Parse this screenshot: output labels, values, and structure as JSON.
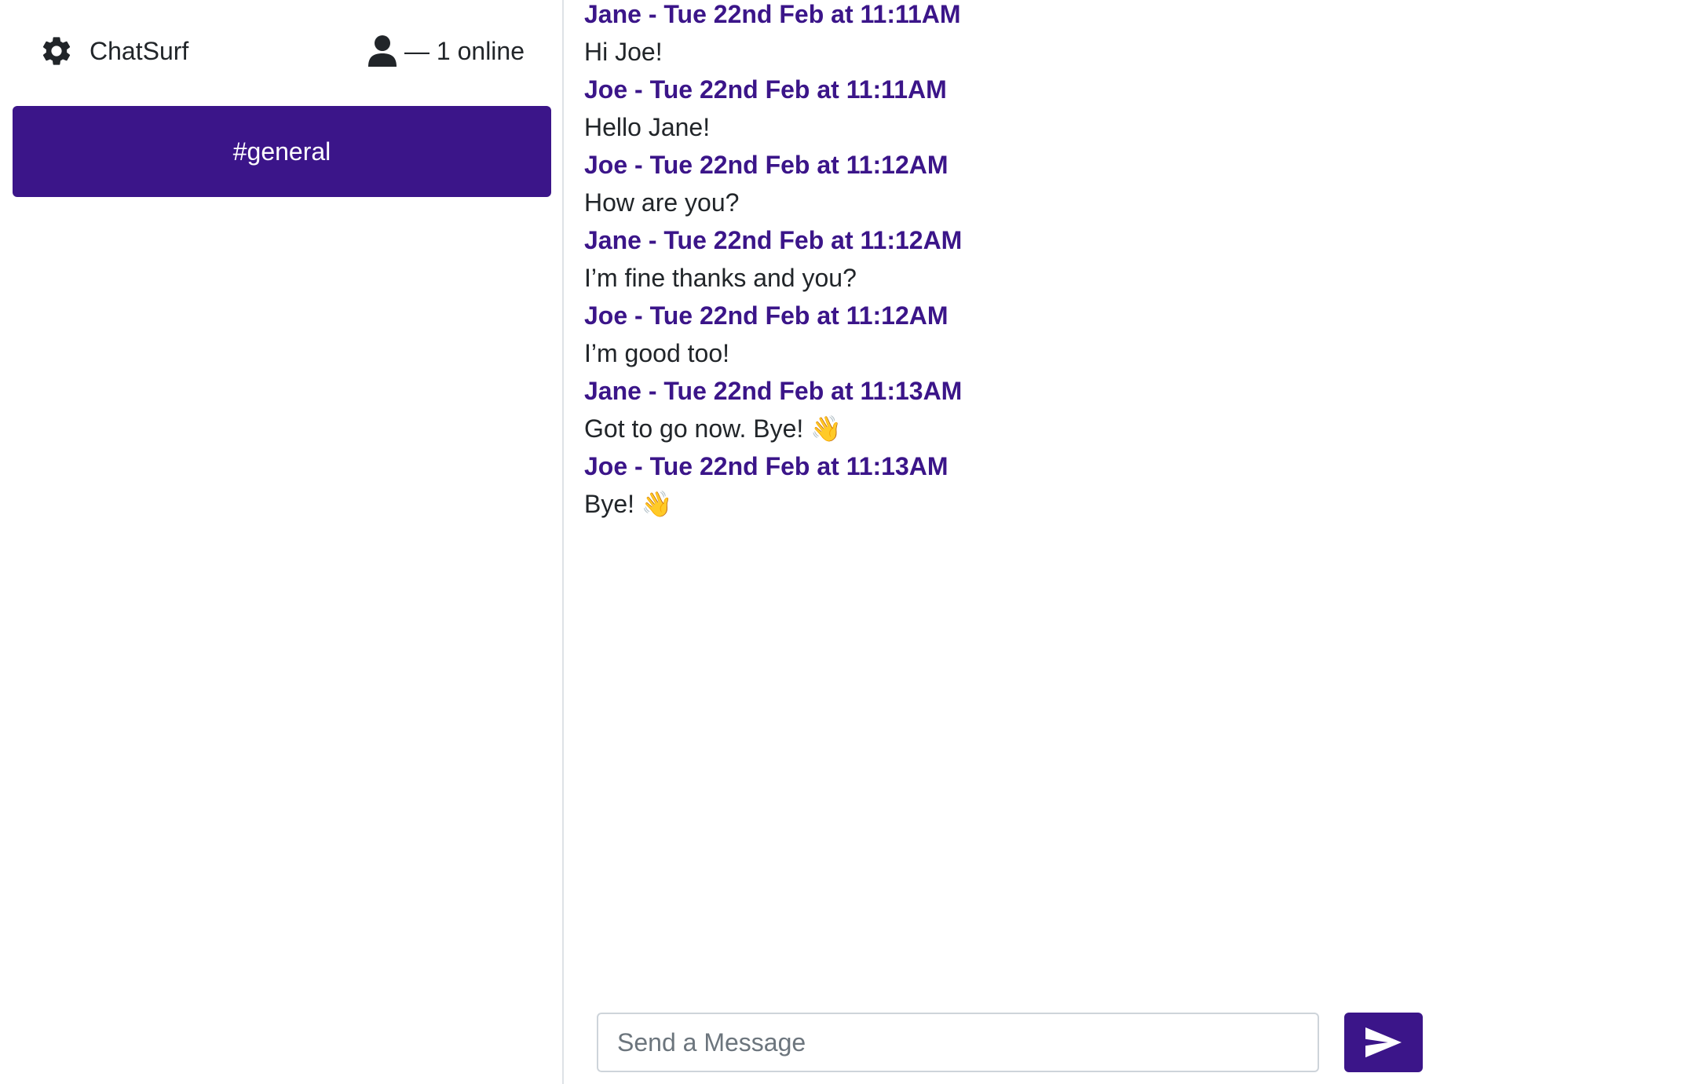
{
  "sidebar": {
    "brand": {
      "icon": "gear-icon",
      "label": "ChatSurf"
    },
    "online": {
      "icon": "user-icon",
      "label": "— 1 online"
    },
    "channels": [
      {
        "label": "#general",
        "active": true
      }
    ]
  },
  "chat": {
    "messages": [
      {
        "author": "Jane - Tue 22nd Feb at 11:11AM",
        "text": "Hi Joe!"
      },
      {
        "author": "Joe - Tue 22nd Feb at 11:11AM",
        "text": "Hello Jane!"
      },
      {
        "author": "Joe - Tue 22nd Feb at 11:12AM",
        "text": "How are you?"
      },
      {
        "author": "Jane - Tue 22nd Feb at 11:12AM",
        "text": "I’m fine thanks and you?"
      },
      {
        "author": "Joe - Tue 22nd Feb at 11:12AM",
        "text": "I’m good too!"
      },
      {
        "author": "Jane - Tue 22nd Feb at 11:13AM",
        "text": "Got to go now. Bye! 👋"
      },
      {
        "author": "Joe - Tue 22nd Feb at 11:13AM",
        "text": "Bye! 👋"
      }
    ],
    "composer": {
      "placeholder": "Send a Message",
      "value": "",
      "send_icon": "send-icon"
    }
  },
  "colors": {
    "accent": "#3b1589",
    "text": "#212529",
    "border": "#dee2e6",
    "placeholder": "#6c757d"
  }
}
